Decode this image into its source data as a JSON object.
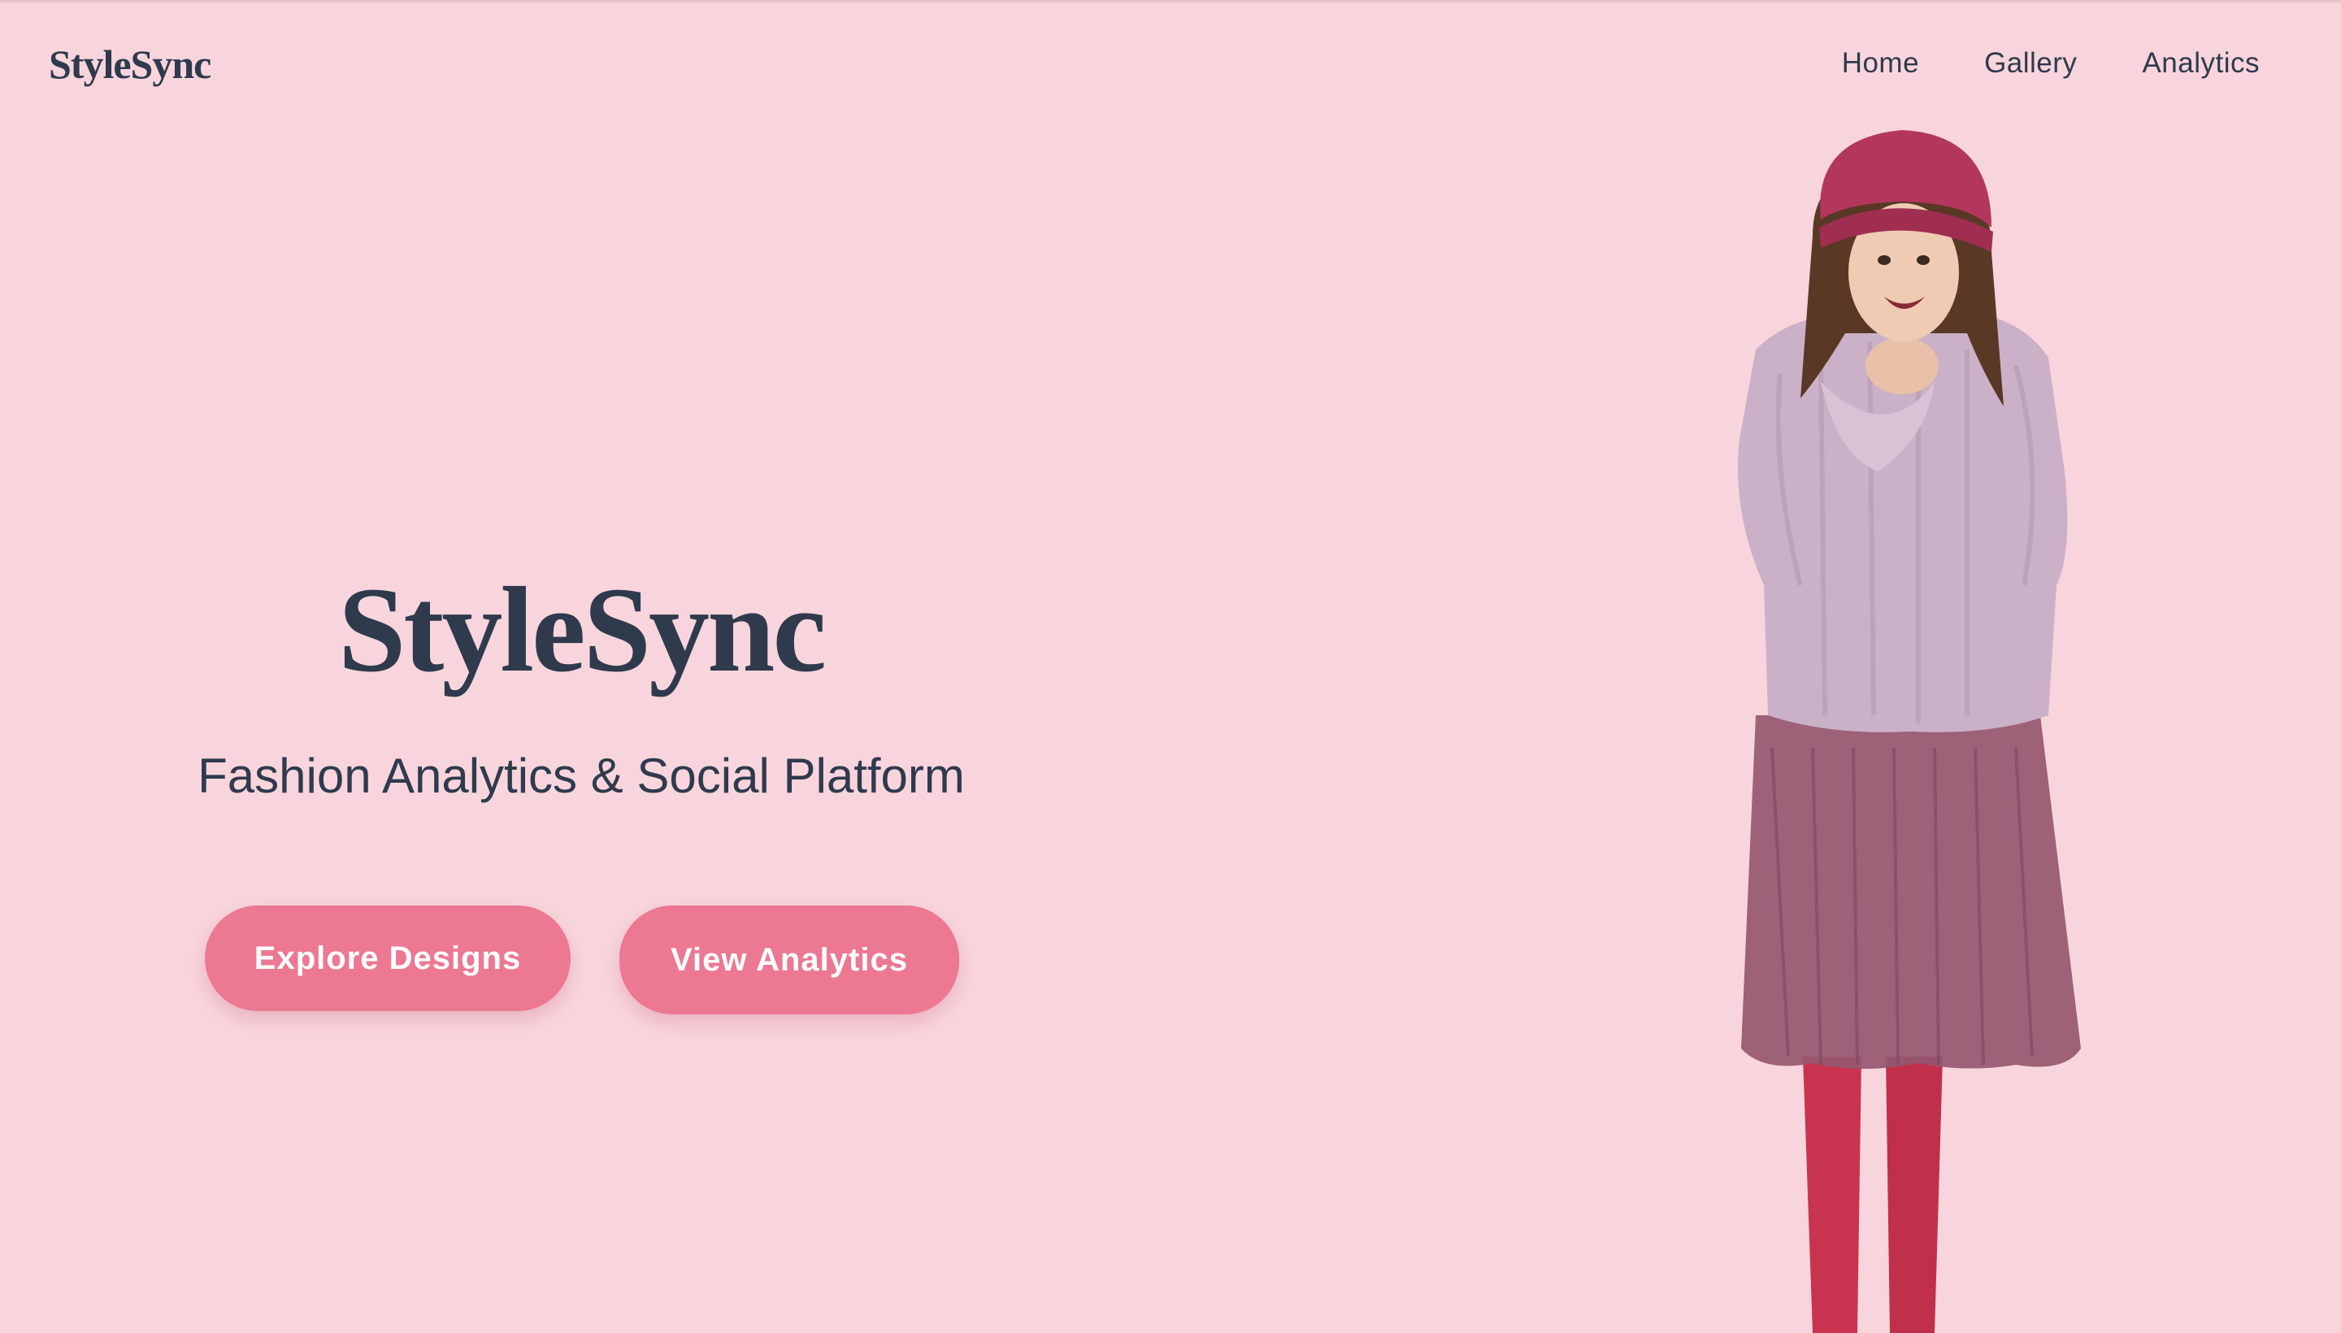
{
  "header": {
    "brand": "StyleSync",
    "nav": [
      {
        "label": "Home"
      },
      {
        "label": "Gallery"
      },
      {
        "label": "Analytics"
      }
    ]
  },
  "hero": {
    "title": "StyleSync",
    "subtitle": "Fashion Analytics & Social Platform",
    "buttons": {
      "explore": "Explore Designs",
      "analytics": "View Analytics"
    },
    "image": "woman-in-pink-knit-hat-and-sweater"
  },
  "colors": {
    "background": "#f8d5dc",
    "text": "#2f3a4d",
    "accent": "#ec7892"
  }
}
